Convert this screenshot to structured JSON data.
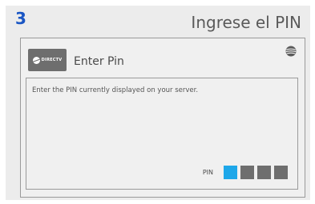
{
  "step": {
    "number": "3",
    "instruction": "Ingrese el PIN"
  },
  "dialog": {
    "brand_logo_text": "DIRECTV",
    "title": "Enter Pin",
    "body": "Enter the PIN currently displayed on your server.",
    "pin_label": "PIN",
    "pin_digits": 4,
    "pin_active_index": 0
  },
  "colors": {
    "step_number": "#1a56c4",
    "pin_active": "#1ea7e9",
    "pin_inactive": "#6e6e6e"
  },
  "icons": {
    "brand": "directv-logo-icon",
    "corner": "att-globe-icon"
  }
}
